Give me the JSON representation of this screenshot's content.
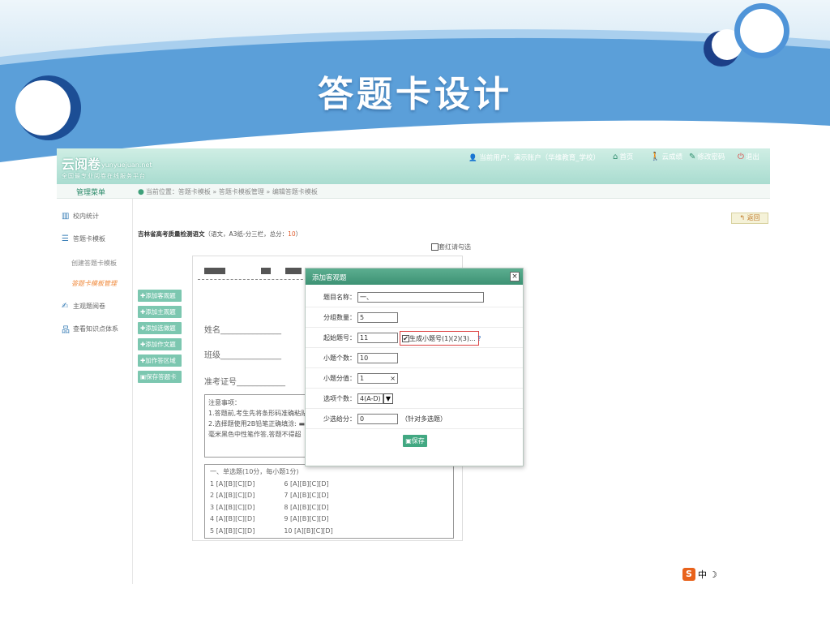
{
  "slide": {
    "title": "答题卡设计"
  },
  "header": {
    "logo": "云阅卷",
    "logo_domain": "yunyuejuan.net",
    "tagline": "全国最专业阅卷在线服务平台",
    "user": "当前用户：演示账户（华维教育_学校）",
    "nav": [
      "首页",
      "云成绩",
      "修改密码",
      "退出"
    ]
  },
  "subbar": {
    "menu_title": "管理菜单",
    "breadcrumb": "当前位置：答题卡模板 » 答题卡模板管理 » 编辑答题卡模板"
  },
  "sidebar": {
    "items": [
      "校内统计",
      "答题卡模板",
      "主观题阅卷",
      "查看知识点体系"
    ],
    "subitems": [
      "创建答题卡模板",
      "答题卡模板管理"
    ]
  },
  "tools": [
    "添加客观题",
    "添加主观题",
    "添加选做题",
    "添加作文题",
    "加作答区域",
    "保存答题卡"
  ],
  "back_label": "返回",
  "document": {
    "title": "吉林省高考质量检测语文",
    "meta_prefix": "（语文，A3纸-分三栏，总分：",
    "score": "10",
    "meta_suffix": "）",
    "mark_check": "套红请勾选",
    "name_label": "姓名",
    "class_label": "班级",
    "exam_no_label": "准考证号",
    "notice_title": "注意事项：",
    "notice_lines": [
      "1.答题前,考生先将条形码准确粘贴",
      "2.选择题使用2B铅笔正确填涂: ▬",
      "毫米黑色中性笔作答,答题不得超"
    ],
    "section_title": "一、单选题(10分，每小题1分)",
    "answers_left": [
      "1 [A][B][C][D]",
      "2 [A][B][C][D]",
      "3 [A][B][C][D]",
      "4 [A][B][C][D]",
      "5 [A][B][C][D]"
    ],
    "answers_right": [
      "6 [A][B][C][D]",
      "7 [A][B][C][D]",
      "8 [A][B][C][D]",
      "9 [A][B][C][D]",
      "10 [A][B][C][D]"
    ]
  },
  "dialog": {
    "title": "添加客观题",
    "close": "×",
    "fields": {
      "name_label": "题目名称：",
      "name_value": "一、",
      "group_label": "分组数量：",
      "group_value": "5",
      "start_label": "起始题号：",
      "start_value": "11",
      "gen_label": "生成小题号(1)(2)(3)...",
      "gen_help": "?",
      "count_label": "小题个数：",
      "count_value": "10",
      "score_label": "小题分值：",
      "score_value": "1",
      "score_clear": "×",
      "options_label": "选项个数：",
      "options_value": "4(A-D)",
      "partial_label": "少选给分：",
      "partial_value": "0",
      "partial_note": "（针对多选题）"
    },
    "save_label": "保存"
  },
  "watermark": "中"
}
